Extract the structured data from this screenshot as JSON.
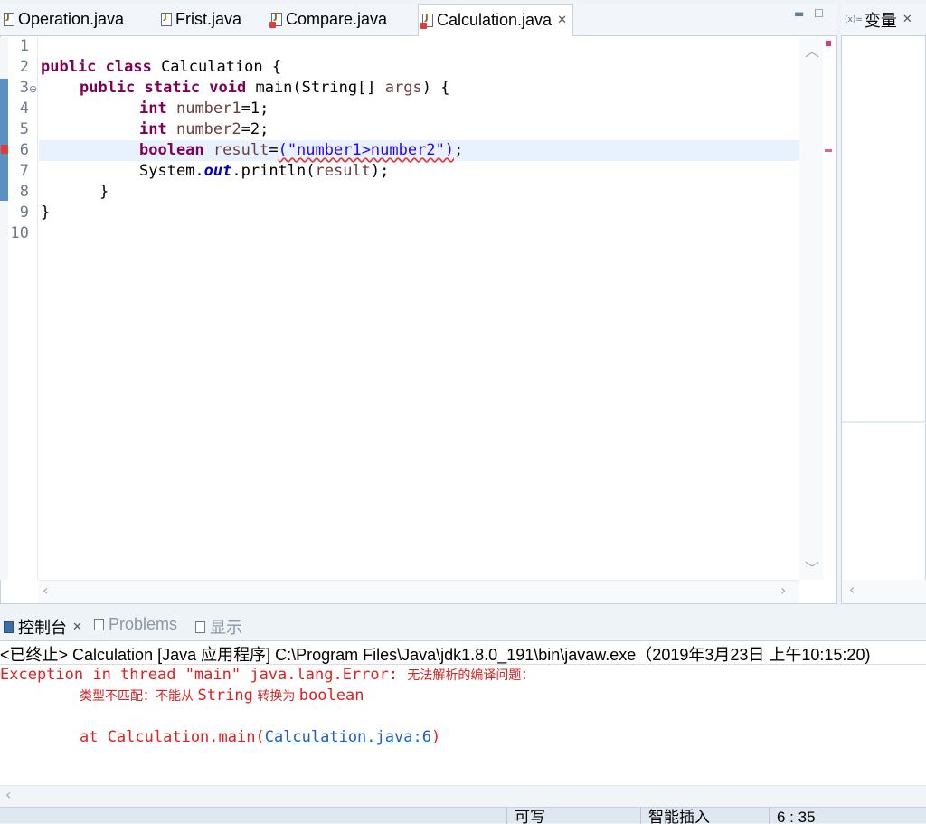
{
  "editor": {
    "tabs": [
      {
        "label": "Operation.java",
        "error": false,
        "active": false
      },
      {
        "label": "Frist.java",
        "error": false,
        "active": false
      },
      {
        "label": "Compare.java",
        "error": true,
        "active": false
      },
      {
        "label": "Calculation.java",
        "error": true,
        "active": true
      }
    ],
    "line_numbers": [
      "1",
      "2",
      "3",
      "4",
      "5",
      "6",
      "7",
      "8",
      "9",
      "10"
    ],
    "code": {
      "l2_kw": "public class",
      "l2_rest": " Calculation {",
      "l3_kw": "public static void",
      "l3_a": " main(String[] ",
      "l3_var": "args",
      "l3_b": ") {",
      "l4_kw": "int",
      "l4_var": "number1",
      "l4_rest": "=1;",
      "l5_kw": "int",
      "l5_var": "number2",
      "l5_rest": "=2;",
      "l6_kw": "boolean",
      "l6_var": "result",
      "l6_eq": "=",
      "l6_err": "(\"number1>number2\")",
      "l6_end": ";",
      "l7_a": "System.",
      "l7_field": "out",
      "l7_b": ".println(",
      "l7_var": "result",
      "l7_c": ");",
      "l8": "}",
      "l9": "}"
    }
  },
  "variables_view": {
    "title": "变量"
  },
  "console": {
    "tabs": [
      {
        "label": "控制台",
        "active": true
      },
      {
        "label": "Problems",
        "active": false
      },
      {
        "label": "显示",
        "active": false
      }
    ],
    "header": "<已终止> Calculation [Java 应用程序] C:\\Program Files\\Java\\jdk1.8.0_191\\bin\\javaw.exe（2019年3月23日 上午10:15:20)",
    "line1_a": "Exception in thread \"main\" java.lang.Error: ",
    "line1_b": "无法解析的编译问题：",
    "line2_a": "类型不匹配：不能从 ",
    "line2_b": "String",
    "line2_c": " 转换为 ",
    "line2_d": "boolean",
    "line3_a": "at Calculation.main(",
    "line3_link": "Calculation.java:6",
    "line3_b": ")"
  },
  "statusbar": {
    "writable": "可写",
    "insert_mode": "智能插入",
    "position": "6 : 35"
  },
  "colors": {
    "keyword": "#7f0055",
    "string": "#2a00ff",
    "error": "#e02020",
    "link": "#1f5fbf",
    "current_line": "#e8f2fe"
  }
}
